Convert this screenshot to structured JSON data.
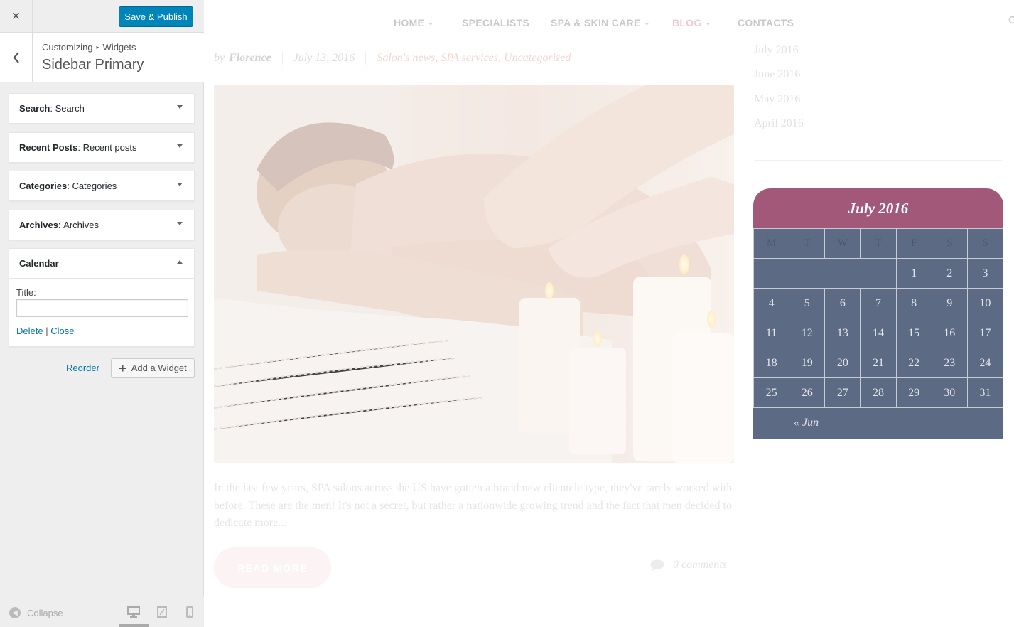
{
  "customizer": {
    "close_icon": "×",
    "save_label": "Save & Publish",
    "breadcrumb": [
      "Customizing",
      "Widgets"
    ],
    "section_title": "Sidebar Primary",
    "widgets": [
      {
        "type": "Search",
        "title": "Search"
      },
      {
        "type": "Recent Posts",
        "title": "Recent posts"
      },
      {
        "type": "Categories",
        "title": "Categories"
      },
      {
        "type": "Archives",
        "title": "Archives"
      },
      {
        "type": "Calendar",
        "title": ""
      }
    ],
    "calendar_form": {
      "title_label": "Title:",
      "title_value": "",
      "delete_label": "Delete",
      "separator": "|",
      "close_label": "Close"
    },
    "reorder_label": "Reorder",
    "add_widget_label": "Add a Widget",
    "collapse_label": "Collapse",
    "icons": [
      "close-icon",
      "back-chevron-icon",
      "expand-arrow-icon",
      "plus-icon",
      "collapse-icon",
      "desktop-icon",
      "tablet-icon",
      "mobile-icon"
    ]
  },
  "site": {
    "nav": [
      {
        "label": "HOME",
        "dropdown": true
      },
      {
        "label": "SPECIALISTS",
        "dropdown": false
      },
      {
        "label": "SPA & SKIN CARE",
        "dropdown": true
      },
      {
        "label": "BLOG",
        "dropdown": true
      },
      {
        "label": "CONTACTS",
        "dropdown": false
      }
    ],
    "post": {
      "by": "by",
      "author": "Florence",
      "date": "July 13, 2016",
      "categories": "Salon's news, SPA services, Uncategorized",
      "excerpt": "In the last few years, SPA salons across the US have gotten a brand new clientele type, they've rarely worked with before. These are the men! It's not a secret, but rather a nationwide growing trend and the fact that men decided to dedicate more...",
      "read_more": "READ MORE",
      "comments": "0 comments"
    },
    "archives": [
      "July 2016",
      "June 2016",
      "May 2016",
      "April 2016"
    ],
    "calendar": {
      "caption": "July 2016",
      "weekdays": [
        "M",
        "T",
        "W",
        "T",
        "F",
        "S",
        "S"
      ],
      "weeks": [
        [
          "",
          "",
          "",
          "",
          "1",
          "2",
          "3"
        ],
        [
          "4",
          "5",
          "6",
          "7",
          "8",
          "9",
          "10"
        ],
        [
          "11",
          "12",
          "13",
          "14",
          "15",
          "16",
          "17"
        ],
        [
          "18",
          "19",
          "20",
          "21",
          "22",
          "23",
          "24"
        ],
        [
          "25",
          "26",
          "27",
          "28",
          "29",
          "30",
          "31"
        ]
      ],
      "prev_link": "« Jun"
    },
    "colors": {
      "caption_bg": "#a25979",
      "calendar_bg": "#5d6a83",
      "accent_blue": "#0085ba"
    }
  }
}
